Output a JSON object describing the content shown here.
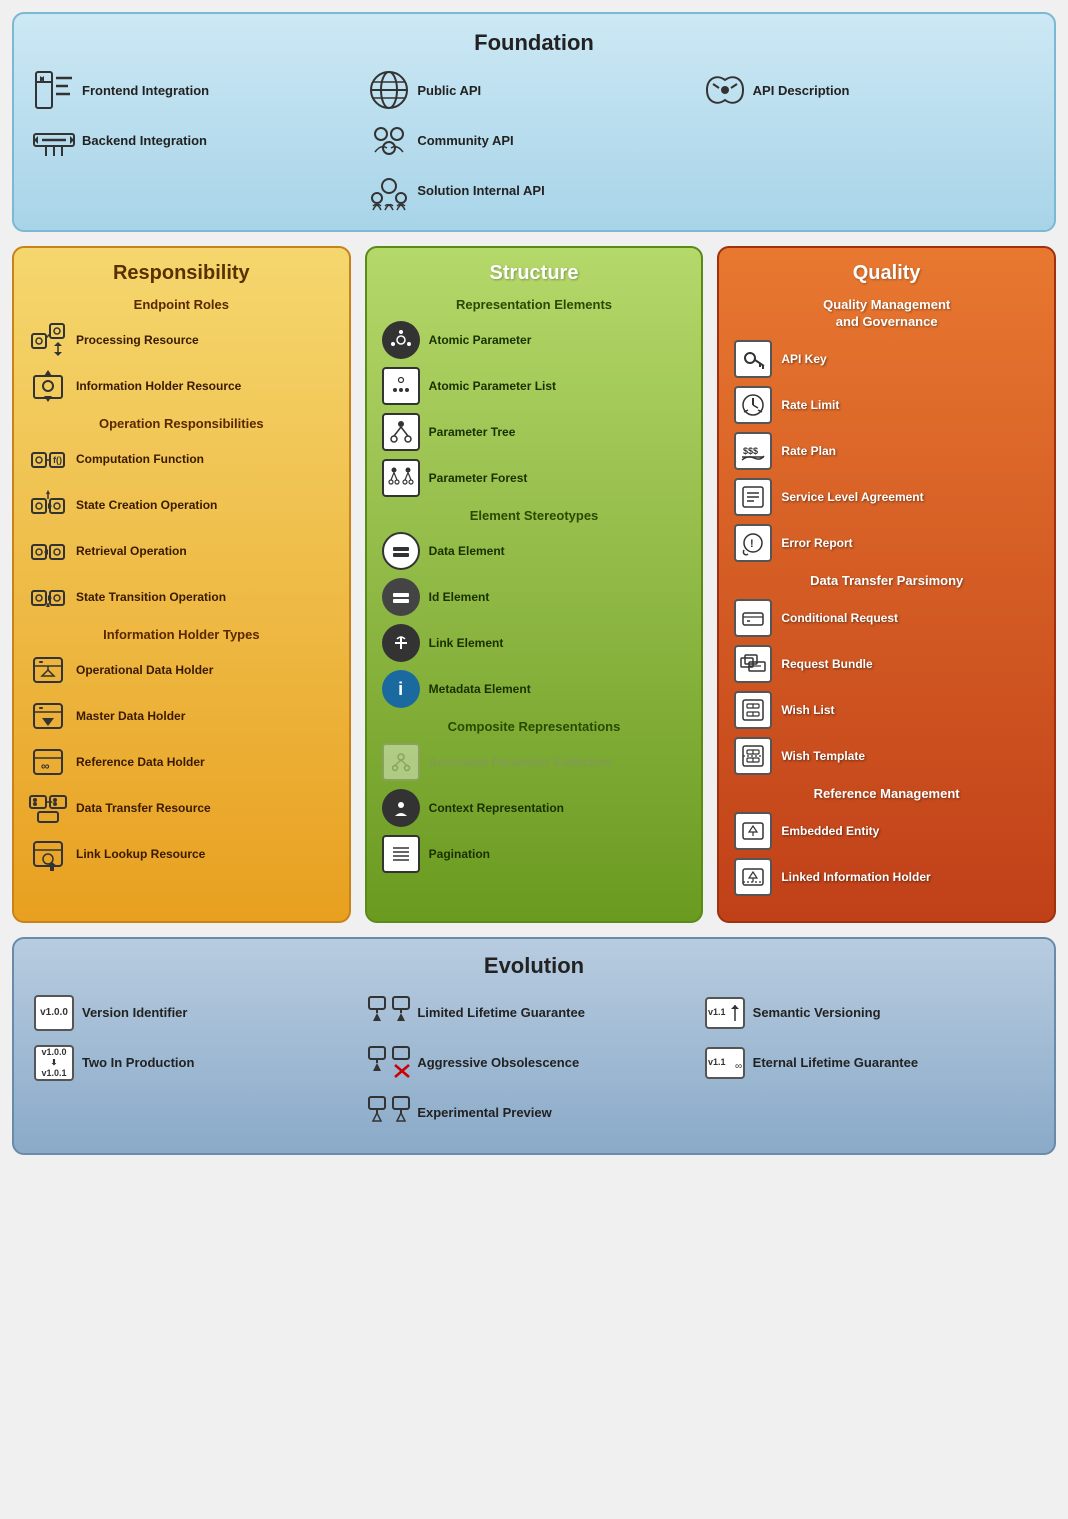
{
  "foundation": {
    "title": "Foundation",
    "items": [
      {
        "label": "Frontend Integration",
        "icon": "frontend-integration-icon",
        "col": 1
      },
      {
        "label": "Public API",
        "icon": "public-api-icon",
        "col": 2
      },
      {
        "label": "API Description",
        "icon": "api-description-icon",
        "col": 3
      },
      {
        "label": "Backend Integration",
        "icon": "backend-integration-icon",
        "col": 1
      },
      {
        "label": "Community API",
        "icon": "community-api-icon",
        "col": 2
      },
      {
        "label": "",
        "icon": "",
        "col": 3
      },
      {
        "label": "Solution Internal API",
        "icon": "solution-internal-api-icon",
        "col": 2
      }
    ]
  },
  "responsibility": {
    "title": "Responsibility",
    "endpoint_roles": {
      "subtitle": "Endpoint Roles",
      "items": [
        {
          "label": "Processing Resource",
          "icon": "processing-resource-icon"
        },
        {
          "label": "Information Holder Resource",
          "icon": "information-holder-icon"
        }
      ]
    },
    "operation_responsibilities": {
      "subtitle": "Operation Responsibilities",
      "items": [
        {
          "label": "Computation Function",
          "icon": "computation-function-icon"
        },
        {
          "label": "State Creation Operation",
          "icon": "state-creation-icon"
        },
        {
          "label": "Retrieval Operation",
          "icon": "retrieval-operation-icon"
        },
        {
          "label": "State Transition Operation",
          "icon": "state-transition-icon"
        }
      ]
    },
    "information_holder_types": {
      "subtitle": "Information Holder Types",
      "items": [
        {
          "label": "Operational Data Holder",
          "icon": "operational-data-holder-icon"
        },
        {
          "label": "Master Data Holder",
          "icon": "master-data-holder-icon"
        },
        {
          "label": "Reference Data Holder",
          "icon": "reference-data-holder-icon"
        },
        {
          "label": "Data Transfer Resource",
          "icon": "data-transfer-resource-icon"
        },
        {
          "label": "Link Lookup Resource",
          "icon": "link-lookup-resource-icon"
        }
      ]
    }
  },
  "structure": {
    "title": "Structure",
    "representation_elements": {
      "subtitle": "Representation Elements",
      "items": [
        {
          "label": "Atomic Parameter",
          "icon": "atomic-parameter-icon"
        },
        {
          "label": "Atomic Parameter List",
          "icon": "atomic-parameter-list-icon"
        },
        {
          "label": "Parameter Tree",
          "icon": "parameter-tree-icon"
        },
        {
          "label": "Parameter Forest",
          "icon": "parameter-forest-icon"
        }
      ]
    },
    "element_stereotypes": {
      "subtitle": "Element Stereotypes",
      "items": [
        {
          "label": "Data Element",
          "icon": "data-element-icon"
        },
        {
          "label": "Id Element",
          "icon": "id-element-icon"
        },
        {
          "label": "Link Element",
          "icon": "link-element-icon"
        },
        {
          "label": "Metadata Element",
          "icon": "metadata-element-icon"
        }
      ]
    },
    "composite_representations": {
      "subtitle": "Composite Representations",
      "items": [
        {
          "label": "Annotated Parameter Collection",
          "icon": "annotated-param-icon",
          "grayed": true
        },
        {
          "label": "Context Representation",
          "icon": "context-representation-icon"
        },
        {
          "label": "Pagination",
          "icon": "pagination-icon"
        }
      ]
    }
  },
  "quality": {
    "title": "Quality",
    "quality_management": {
      "subtitle": "Quality Management and Governance",
      "items": [
        {
          "label": "API Key",
          "icon": "api-key-icon"
        },
        {
          "label": "Rate Limit",
          "icon": "rate-limit-icon"
        },
        {
          "label": "Rate Plan",
          "icon": "rate-plan-icon"
        },
        {
          "label": "Service Level Agreement",
          "icon": "sla-icon"
        },
        {
          "label": "Error Report",
          "icon": "error-report-icon"
        }
      ]
    },
    "data_transfer": {
      "subtitle": "Data Transfer Parsimony",
      "items": [
        {
          "label": "Conditional Request",
          "icon": "conditional-request-icon"
        },
        {
          "label": "Request Bundle",
          "icon": "request-bundle-icon"
        },
        {
          "label": "Wish List",
          "icon": "wish-list-icon"
        },
        {
          "label": "Wish Template",
          "icon": "wish-template-icon"
        }
      ]
    },
    "reference_management": {
      "subtitle": "Reference Management",
      "items": [
        {
          "label": "Embedded Entity",
          "icon": "embedded-entity-icon"
        },
        {
          "label": "Linked Information Holder",
          "icon": "linked-information-holder-icon"
        }
      ]
    }
  },
  "evolution": {
    "title": "Evolution",
    "items": [
      {
        "label": "Version Identifier",
        "icon": "version-identifier-icon",
        "col": 1
      },
      {
        "label": "Two In Production",
        "icon": "two-in-production-icon",
        "col": 2
      },
      {
        "label": "Limited Lifetime Guarantee",
        "icon": "limited-lifetime-icon",
        "col": 3
      },
      {
        "label": "Semantic Versioning",
        "icon": "semantic-versioning-icon",
        "col": 1
      },
      {
        "label": "Aggressive Obsolescence",
        "icon": "aggressive-obsolescence-icon",
        "col": 2
      },
      {
        "label": "Eternal Lifetime Guarantee",
        "icon": "eternal-lifetime-icon",
        "col": 3
      },
      {
        "label": "Experimental Preview",
        "icon": "experimental-preview-icon",
        "col": 2
      }
    ]
  }
}
